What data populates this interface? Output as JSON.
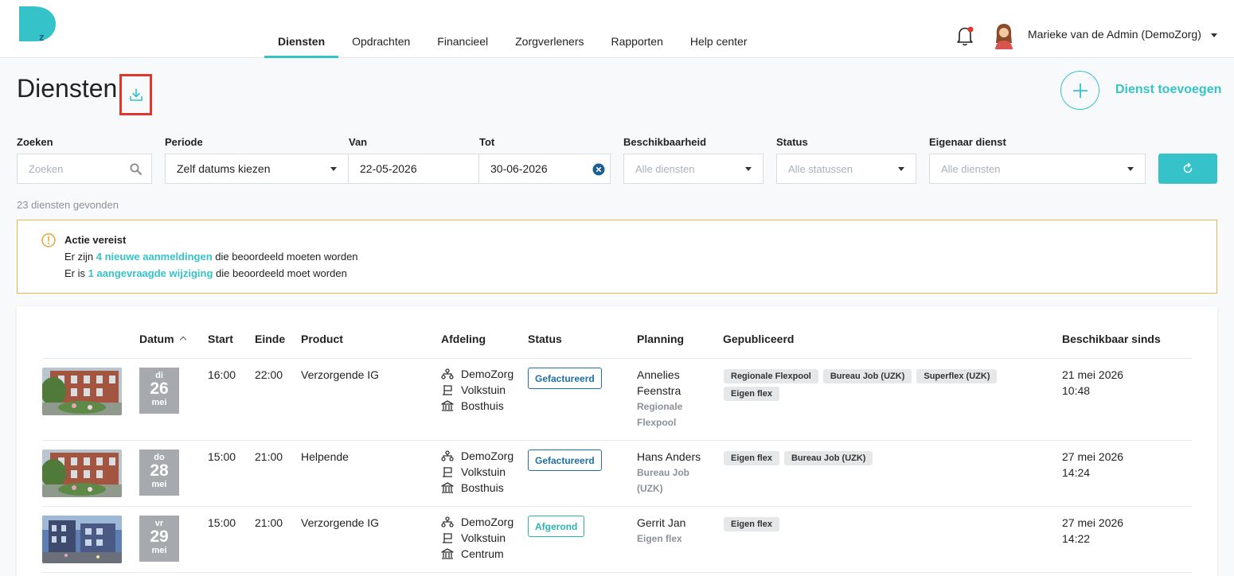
{
  "nav": {
    "items": [
      {
        "label": "Diensten",
        "active": true
      },
      {
        "label": "Opdrachten"
      },
      {
        "label": "Financieel"
      },
      {
        "label": "Zorgverleners"
      },
      {
        "label": "Rapporten"
      },
      {
        "label": "Help center"
      }
    ]
  },
  "user": {
    "name": "Marieke van de Admin (DemoZorg)"
  },
  "page": {
    "title": "Diensten",
    "add_label": "Dienst toevoegen"
  },
  "filters": {
    "search": {
      "label": "Zoeken",
      "placeholder": "Zoeken"
    },
    "periode": {
      "label": "Periode",
      "value": "Zelf datums kiezen"
    },
    "van": {
      "label": "Van",
      "value": "22-05-2026"
    },
    "tot": {
      "label": "Tot",
      "value": "30-06-2026"
    },
    "beschikbaarheid": {
      "label": "Beschikbaarheid",
      "placeholder": "Alle diensten"
    },
    "status": {
      "label": "Status",
      "placeholder": "Alle statussen"
    },
    "eigenaar": {
      "label": "Eigenaar dienst",
      "placeholder": "Alle diensten"
    }
  },
  "result_count": "23 diensten gevonden",
  "alert": {
    "title": "Actie vereist",
    "line1": {
      "pre": "Er zijn ",
      "link": "4 nieuwe aanmeldingen",
      "post": " die beoordeeld moeten worden"
    },
    "line2": {
      "pre": "Er is ",
      "link": "1 aangevraagde wijziging",
      "post": " die beoordeeld moet worden"
    }
  },
  "colors": {
    "accent": "#35c3c9",
    "warning": "#e8b44c",
    "invoiced": "#1f6fa8",
    "done": "#2bb5b0"
  },
  "table": {
    "headers": {
      "datum": "Datum",
      "start": "Start",
      "einde": "Einde",
      "product": "Product",
      "afdeling": "Afdeling",
      "status": "Status",
      "planning": "Planning",
      "gepubliceerd": "Gepubliceerd",
      "beschikbaar": "Beschikbaar sinds"
    },
    "rows": [
      {
        "day": "di",
        "date": "26",
        "month": "mei",
        "start": "16:00",
        "end": "22:00",
        "product": "Verzorgende IG",
        "afdeling": [
          "DemoZorg",
          "Volkstuin",
          "Bosthuis"
        ],
        "status": "Gefactureerd",
        "planning_name1": "Annelies",
        "planning_name2": "Feenstra",
        "planning_sub1": "Regionale",
        "planning_sub2": "Flexpool",
        "tags": [
          "Regionale Flexpool",
          "Bureau Job (UZK)",
          "Superflex (UZK)",
          "Eigen flex"
        ],
        "since_date": "21 mei 2026",
        "since_time": "10:48"
      },
      {
        "day": "do",
        "date": "28",
        "month": "mei",
        "start": "15:00",
        "end": "21:00",
        "product": "Helpende",
        "afdeling": [
          "DemoZorg",
          "Volkstuin",
          "Bosthuis"
        ],
        "status": "Gefactureerd",
        "planning_name1": "Hans Anders",
        "planning_name2": "",
        "planning_sub1": "Bureau Job",
        "planning_sub2": "(UZK)",
        "tags": [
          "Eigen flex",
          "Bureau Job (UZK)"
        ],
        "since_date": "27 mei 2026",
        "since_time": "14:24"
      },
      {
        "day": "vr",
        "date": "29",
        "month": "mei",
        "start": "15:00",
        "end": "21:00",
        "product": "Verzorgende IG",
        "afdeling": [
          "DemoZorg",
          "Volkstuin",
          "Centrum"
        ],
        "status": "Afgerond",
        "planning_name1": "Gerrit Jan",
        "planning_name2": "",
        "planning_sub1": "Eigen flex",
        "planning_sub2": "",
        "tags": [
          "Eigen flex"
        ],
        "since_date": "27 mei 2026",
        "since_time": "14:22"
      }
    ]
  }
}
